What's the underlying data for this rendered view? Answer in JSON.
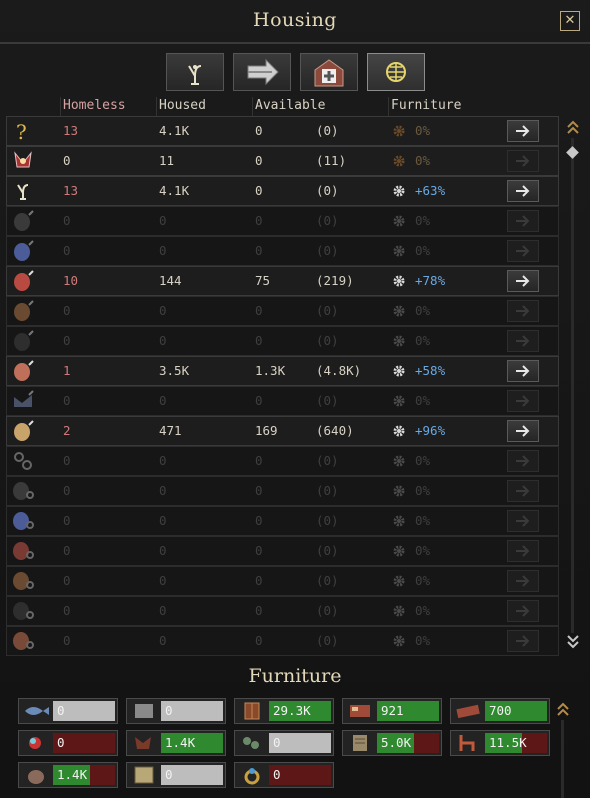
{
  "window": {
    "title": "Housing",
    "close_symbol": "✕"
  },
  "tabs": [
    {
      "icon": "citizen-icon",
      "active": false
    },
    {
      "icon": "transfer-arrow-icon",
      "active": false
    },
    {
      "icon": "hospital-icon",
      "active": false
    },
    {
      "icon": "globe-icon",
      "active": true
    }
  ],
  "columns": {
    "homeless": "Homeless",
    "housed": "Housed",
    "available": "Available",
    "furniture": "Furniture"
  },
  "rows": [
    {
      "icon": "question-icon",
      "homeless": "13",
      "housed": "4.1K",
      "available": "0",
      "avail_paren": "(0)",
      "furniture": "0%",
      "active": true,
      "has_arrow": true,
      "arrow_enabled": true
    },
    {
      "icon": "noble-crest-icon",
      "homeless": "0",
      "housed": "11",
      "available": "0",
      "avail_paren": "(11)",
      "furniture": "0%",
      "active": true,
      "has_arrow": true,
      "arrow_enabled": false
    },
    {
      "icon": "citizen-icon",
      "homeless": "13",
      "housed": "4.1K",
      "available": "0",
      "avail_paren": "(0)",
      "furniture": "+63%",
      "active": true,
      "has_arrow": true,
      "arrow_enabled": true
    },
    {
      "icon": "dwarf-silhouette-icon",
      "homeless": "0",
      "housed": "0",
      "available": "0",
      "avail_paren": "(0)",
      "furniture": "0%",
      "active": false,
      "has_arrow": true,
      "arrow_enabled": false
    },
    {
      "icon": "blue-face-icon",
      "homeless": "0",
      "housed": "0",
      "available": "0",
      "avail_paren": "(0)",
      "furniture": "0%",
      "active": false,
      "has_arrow": true,
      "arrow_enabled": false
    },
    {
      "icon": "red-dwarf-icon",
      "homeless": "10",
      "housed": "144",
      "available": "75",
      "avail_paren": "(219)",
      "furniture": "+78%",
      "active": true,
      "has_arrow": true,
      "arrow_enabled": true
    },
    {
      "icon": "brown-face-icon",
      "homeless": "0",
      "housed": "0",
      "available": "0",
      "avail_paren": "(0)",
      "furniture": "0%",
      "active": false,
      "has_arrow": false,
      "arrow_enabled": false
    },
    {
      "icon": "dark-face-icon",
      "homeless": "0",
      "housed": "0",
      "available": "0",
      "avail_paren": "(0)",
      "furniture": "0%",
      "active": false,
      "has_arrow": false,
      "arrow_enabled": false
    },
    {
      "icon": "human-woman-icon",
      "homeless": "1",
      "housed": "3.5K",
      "available": "1.3K",
      "avail_paren": "(4.8K)",
      "furniture": "+58%",
      "active": true,
      "has_arrow": true,
      "arrow_enabled": true
    },
    {
      "icon": "wolf-icon",
      "homeless": "0",
      "housed": "0",
      "available": "0",
      "avail_paren": "(0)",
      "furniture": "0%",
      "active": false,
      "has_arrow": false,
      "arrow_enabled": false
    },
    {
      "icon": "human-elder-icon",
      "homeless": "2",
      "housed": "471",
      "available": "169",
      "avail_paren": "(640)",
      "furniture": "+96%",
      "active": true,
      "has_arrow": true,
      "arrow_enabled": true
    },
    {
      "icon": "chain-icon",
      "homeless": "0",
      "housed": "0",
      "available": "0",
      "avail_paren": "(0)",
      "furniture": "0%",
      "active": false,
      "has_arrow": false,
      "arrow_enabled": false
    },
    {
      "icon": "chained-dwarf-icon",
      "homeless": "0",
      "housed": "0",
      "available": "0",
      "avail_paren": "(0)",
      "furniture": "0%",
      "active": false,
      "has_arrow": false,
      "arrow_enabled": false
    },
    {
      "icon": "chained-blue-face-icon",
      "homeless": "0",
      "housed": "0",
      "available": "0",
      "avail_paren": "(0)",
      "furniture": "0%",
      "active": false,
      "has_arrow": false,
      "arrow_enabled": false
    },
    {
      "icon": "chained-red-dwarf-icon",
      "homeless": "0",
      "housed": "0",
      "available": "0",
      "avail_paren": "(0)",
      "furniture": "0%",
      "active": false,
      "has_arrow": false,
      "arrow_enabled": false
    },
    {
      "icon": "chained-brown-face-icon",
      "homeless": "0",
      "housed": "0",
      "available": "0",
      "avail_paren": "(0)",
      "furniture": "0%",
      "active": false,
      "has_arrow": false,
      "arrow_enabled": false
    },
    {
      "icon": "chained-dark-face-icon",
      "homeless": "0",
      "housed": "0",
      "available": "0",
      "avail_paren": "(0)",
      "furniture": "0%",
      "active": false,
      "has_arrow": false,
      "arrow_enabled": false
    },
    {
      "icon": "chained-woman-icon",
      "homeless": "0",
      "housed": "0",
      "available": "0",
      "avail_paren": "(0)",
      "furniture": "0%",
      "active": false,
      "has_arrow": false,
      "arrow_enabled": false
    }
  ],
  "furniture_section": {
    "title": "Furniture",
    "items": [
      {
        "icon": "fish-icon",
        "value": "0",
        "bar": "gray"
      },
      {
        "icon": "stone-icon",
        "value": "0",
        "bar": "gray"
      },
      {
        "icon": "wardrobe-icon",
        "value": "29.3K",
        "bar": "green"
      },
      {
        "icon": "bed-icon",
        "value": "921",
        "bar": "green"
      },
      {
        "icon": "rug-icon",
        "value": "700",
        "bar": "green"
      },
      {
        "icon": "gem-ring-icon",
        "value": "0",
        "bar": "red"
      },
      {
        "icon": "pelt-icon",
        "value": "1.4K",
        "bar": "green"
      },
      {
        "icon": "herbs-icon",
        "value": "0",
        "bar": "gray"
      },
      {
        "icon": "book-icon",
        "value": "5.0K",
        "bar": "mix"
      },
      {
        "icon": "chair-icon",
        "value": "11.5K",
        "bar": "mix"
      },
      {
        "icon": "sack-icon",
        "value": "1.4K",
        "bar": "mix"
      },
      {
        "icon": "crate-icon",
        "value": "0",
        "bar": "gray"
      },
      {
        "icon": "ring-icon",
        "value": "0",
        "bar": "red"
      }
    ]
  }
}
